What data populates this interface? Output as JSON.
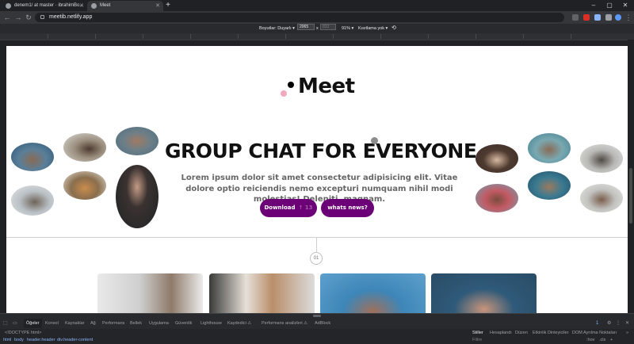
{
  "browser": {
    "tabs": [
      {
        "title": "denem1/ at master · ibrahimBo..."
      },
      {
        "title": "Meet"
      }
    ],
    "new_tab": "+",
    "window_controls": {
      "minimize": "–",
      "maximize": "▢",
      "close": "✕"
    },
    "url": "meetib.netlify.app"
  },
  "device_toolbar": {
    "dimensions_label": "Boyutlar: Duyarlı ▾",
    "width": "2065",
    "separator": "x",
    "height": "833",
    "zoom": "91% ▾",
    "throttling": "Kısıtlama yok ▾"
  },
  "page": {
    "logo_text": "Meet",
    "headline": "GROUP CHAT FOR EVERYONE",
    "lead": "Lorem ipsum dolor sit amet consectetur adipisicing elit. Vitae dolore optio reiciendis nemo excepturi numquam nihil modi molestias! Deleniti, magnam.",
    "buttons": {
      "download": "Download",
      "download_hint": "↑ 13",
      "whats_news": "whats news?"
    },
    "step_label": "01",
    "colors": {
      "button": "#6b0077",
      "accent_pink": "#f1a9bd"
    }
  },
  "devtools": {
    "tabs": [
      "Öğeler",
      "Konsol",
      "Kaynaklar",
      "Ağ",
      "Performans",
      "Bellek",
      "Uygulama",
      "Güvenlik",
      "Lighthouse",
      "Kaydedici ⚠",
      "Performans analizleri ⚠",
      "AdBlock"
    ],
    "badge": "1",
    "doctype": "<!DOCTYPE html>",
    "breadcrumbs": [
      "html",
      "body",
      "header.header",
      "div.header-content"
    ],
    "side_tabs": [
      "Stiller",
      "Hesaplandı",
      "Düzen",
      "Etkinlik Dinleyiciler",
      "DOM Ayrılma Noktaları"
    ],
    "side_more": "»",
    "filter_placeholder": "Filtre",
    "hov": ":hov",
    "cls": ".cls"
  }
}
